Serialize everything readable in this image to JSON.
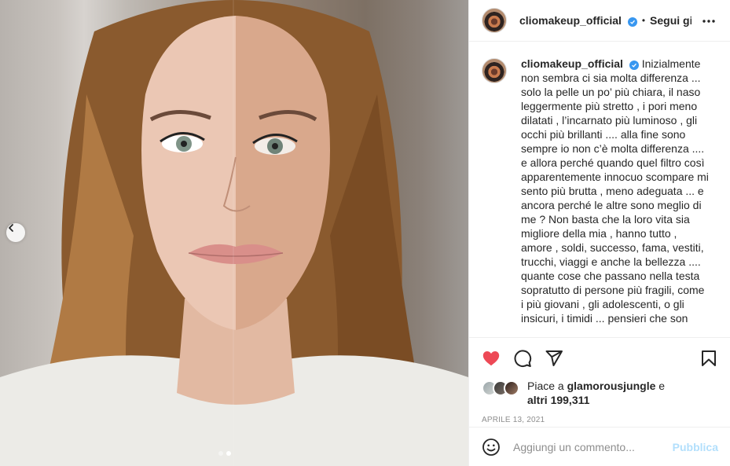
{
  "post": {
    "username": "cliomakeup_official",
    "follow_label": "Segui già",
    "caption": "Inizialmente non sembra ci sia molta differenza ... solo la pelle un po’ più chiara, il naso leggermente più stretto , i pori meno dilatati , l’incarnato più luminoso , gli occhi più brillanti .... alla fine sono sempre io non c’è molta differenza .... e allora perché quando quel filtro così apparentemente innocuo scompare mi sento più brutta , meno adeguata ... e ancora perché le altre sono meglio di me ? Non basta che la loro vita sia migliore della mia , hanno tutto , amore , soldi, successo, fama, vestiti, trucchi, viaggi e anche la bellezza .... quante cose che passano nella testa sopratutto di persone più fragili, come i più giovani , gli adolescenti, o gli insicuri, i timidi ... pensieri che son",
    "likes_prefix": "Piace a",
    "likes_user": "glamorousjungle",
    "likes_conj": "e",
    "likes_others": "altri 199,311",
    "date": "APRILE 13, 2021"
  },
  "comment": {
    "placeholder": "Aggiungi un commento...",
    "publish_label": "Pubblica"
  },
  "colors": {
    "like_red": "#ed4956",
    "verified_blue": "#3897f0",
    "publish_disabled": "#b2dffc"
  },
  "icons": {
    "like": "heart-icon",
    "comment": "comment-icon",
    "share": "send-icon",
    "save": "bookmark-icon",
    "more": "more-dots-icon",
    "emoji": "emoji-icon",
    "prev": "chevron-left-icon"
  },
  "carousel": {
    "slide_count": 2,
    "active_slide": 2
  }
}
